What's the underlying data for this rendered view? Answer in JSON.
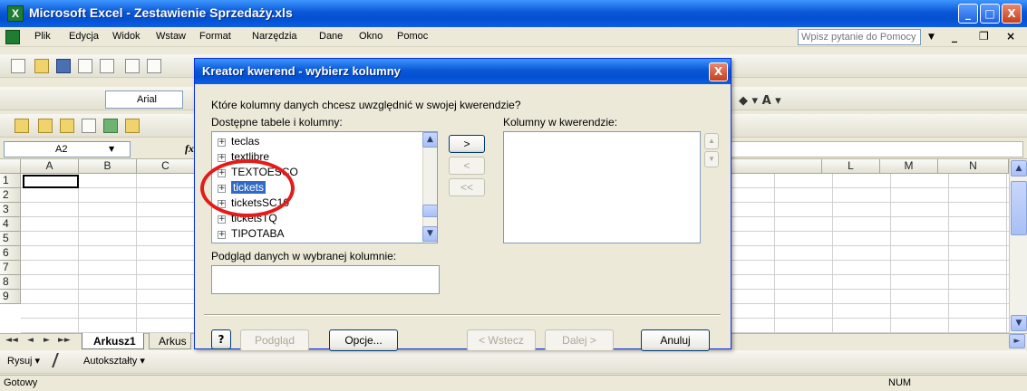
{
  "window": {
    "title": "Microsoft Excel - Zestawienie Sprzedaży.xls",
    "app_icon": "excel-icon",
    "caption_minimize": "_",
    "caption_maximize": "□",
    "caption_close": "X"
  },
  "menu": {
    "items": [
      "Plik",
      "Edycja",
      "Widok",
      "Wstaw",
      "Format",
      "Narzędzia",
      "Dane",
      "Okno",
      "Pomoc"
    ],
    "help_placeholder": "Wpisz pytanie do Pomocy",
    "help_arrow": "▼",
    "mdi_minimize": "_",
    "mdi_restore": "❐",
    "mdi_close": "×"
  },
  "formatting_toolbar": {
    "font_name": "Arial",
    "right_controls": "◆ ▾ A ▾"
  },
  "formula_bar": {
    "name_box": "A2",
    "fx": "fx"
  },
  "grid": {
    "columns": [
      "A",
      "B",
      "C",
      "L",
      "M",
      "N"
    ],
    "rows": [
      "1",
      "2",
      "3",
      "4",
      "5",
      "6",
      "7",
      "8",
      "9"
    ]
  },
  "sheets": {
    "nav": [
      "◄◄",
      "◄",
      "►",
      "►►"
    ],
    "active": "Arkusz1",
    "second": "Arkus"
  },
  "drawing_toolbar": {
    "draw": "Rysuj ▾",
    "autoshapes": "Autokształty ▾"
  },
  "status": {
    "text": "Gotowy",
    "num": "NUM"
  },
  "dialog": {
    "title": "Kreator kwerend - wybierz kolumny",
    "close": "X",
    "question": "Które kolumny danych chcesz uwzględnić w swojej kwerendzie?",
    "available_label": "Dostępne tabele i kolumny:",
    "query_label": "Kolumny w kwerendzie:",
    "available_items": [
      "teclas",
      "textlibre",
      "TEXTOESCO",
      "tickets",
      "ticketsSC10",
      "ticketsTQ",
      "TIPOTABA"
    ],
    "selected_item": "tickets",
    "expand_glyph": "+",
    "move_right": ">",
    "move_left": "<",
    "move_all_left": "<<",
    "preview_label": "Podgląd danych w wybranej kolumnie:",
    "help_button": "?",
    "buttons": {
      "preview": "Podgląd",
      "options": "Opcje...",
      "back": "< Wstecz",
      "next": "Dalej >",
      "cancel": "Anuluj"
    }
  },
  "colors": {
    "title_blue": "#0a58d6",
    "selection_blue": "#316ac5",
    "annotation_red": "#e51b1b"
  }
}
